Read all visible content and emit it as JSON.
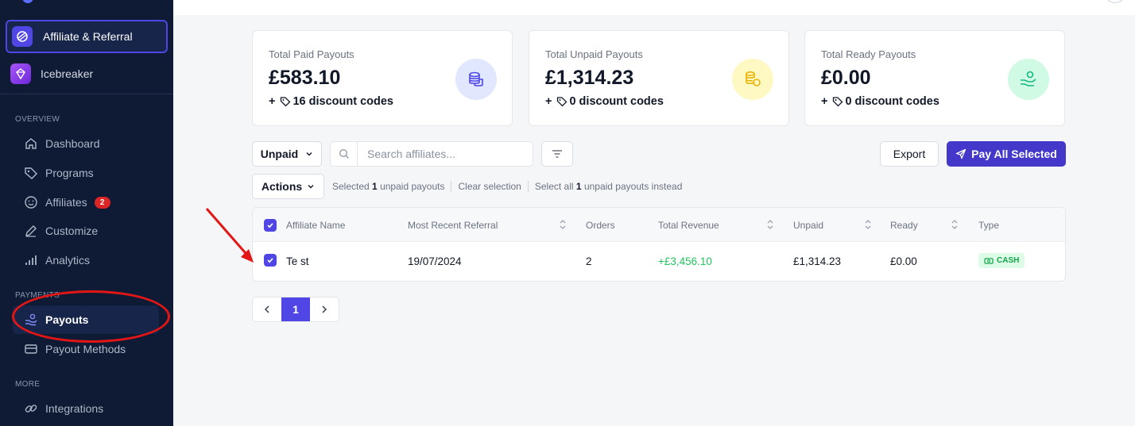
{
  "sidebar": {
    "apps": [
      {
        "label": "Affiliate & Referral",
        "active": true
      },
      {
        "label": "Icebreaker",
        "active": false
      }
    ],
    "sections": {
      "overview": "OVERVIEW",
      "payments": "PAYMENTS",
      "more": "MORE"
    },
    "nav": {
      "dashboard": "Dashboard",
      "programs": "Programs",
      "affiliates": "Affiliates",
      "affiliates_badge": "2",
      "customize": "Customize",
      "analytics": "Analytics",
      "payouts": "Payouts",
      "payout_methods": "Payout Methods",
      "integrations": "Integrations"
    }
  },
  "cards": [
    {
      "title": "Total Paid Payouts",
      "value": "£583.10",
      "plus": "+",
      "sub": "16 discount codes",
      "icon": "coins-icon",
      "color": "#4f46e5"
    },
    {
      "title": "Total Unpaid Payouts",
      "value": "£1,314.23",
      "plus": "+",
      "sub": "0 discount codes",
      "icon": "coins-clock-icon",
      "color": "#eab308"
    },
    {
      "title": "Total Ready Payouts",
      "value": "£0.00",
      "plus": "+",
      "sub": "0 discount codes",
      "icon": "hand-coins-icon",
      "color": "#10b981"
    }
  ],
  "controls": {
    "status_filter": "Unpaid",
    "search_placeholder": "Search affiliates...",
    "export": "Export",
    "pay_all": "Pay All Selected",
    "actions": "Actions",
    "selection": {
      "selected_prefix": "Selected",
      "selected_count": "1",
      "selected_suffix": "unpaid payouts",
      "clear": "Clear selection",
      "select_all_prefix": "Select all",
      "select_all_count": "1",
      "select_all_suffix": "unpaid payouts instead"
    }
  },
  "table": {
    "headers": {
      "name": "Affiliate Name",
      "referral": "Most Recent Referral",
      "orders": "Orders",
      "revenue": "Total Revenue",
      "unpaid": "Unpaid",
      "ready": "Ready",
      "type": "Type"
    },
    "rows": [
      {
        "name": "Te st",
        "referral": "19/07/2024",
        "orders": "2",
        "revenue": "+£3,456.10",
        "unpaid": "£1,314.23",
        "ready": "£0.00",
        "type": "CASH",
        "checked": true
      }
    ]
  },
  "pagination": {
    "current": "1"
  },
  "colors": {
    "accent": "#4f46e5",
    "sidebar_bg": "#0f1b35",
    "positive": "#22c55e",
    "annotation": "#e31616"
  }
}
